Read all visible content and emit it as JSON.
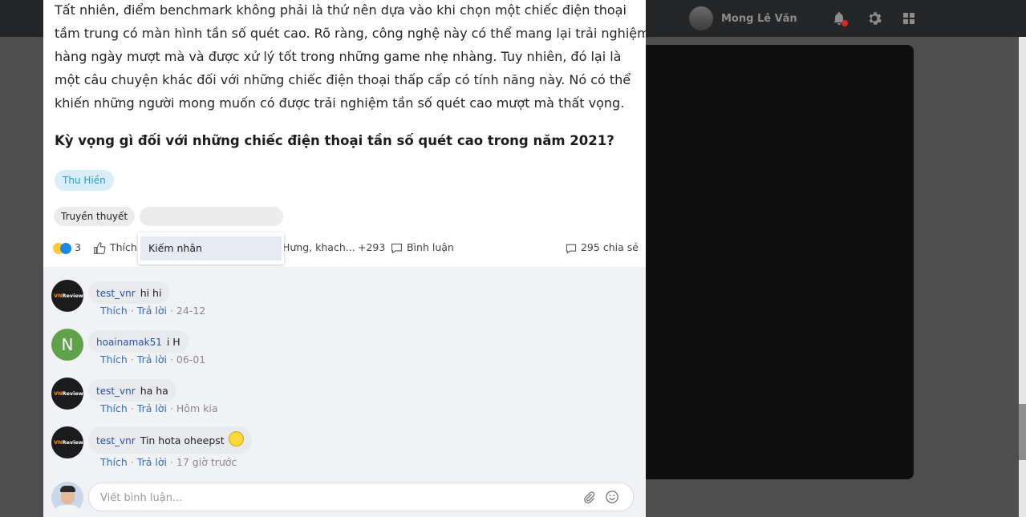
{
  "header": {
    "user_name": "Mong Lê Văn",
    "icons": [
      "bell-icon",
      "gear-icon",
      "grid-icon"
    ]
  },
  "article": {
    "paragraph": "Tất nhiên, điểm benchmark không phải là thứ nên dựa vào khi chọn một chiếc điện thoại tầm trung có màn hình tần số quét cao. Rõ ràng, công nghệ này có thể mang lại trải nghiệm hàng ngày mượt mà và được xử lý tốt trong những game nhẹ nhàng. Tuy nhiên, đó lại là một câu chuyện khác đối với những chiếc điện thoại thấp cấp có tính năng này. Nó có thể khiến những người mong muốn có được trải nghiệm tần số quét cao mượt mà thất vọng.",
    "lines": [
      "Tất nhiên, điểm benchmark không phải là thứ nên dựa vào khi chọn một chiếc điện thoại",
      "tầm trung có màn hình tần số quét cao. Rõ ràng, công nghệ này có thể mang lại trải nghiệm",
      "hàng ngày mượt mà và được xử lý tốt trong những game nhẹ nhàng. Tuy nhiên, đó lại là",
      "một câu chuyện khác đối với những chiếc điện thoại thấp cấp có tính năng này. Nó có thể",
      "khiến những người mong muốn có được trải nghiệm tần số quét cao mượt mà thất vọng."
    ],
    "heading": "Kỳ vọng gì đối với những chiếc điện thoại tần số quét cao trong năm 2021?"
  },
  "author_tag": "Thu Hiền",
  "tags": [
    "Truyền thuyết"
  ],
  "dropdown": {
    "item": "Kiếm nhân"
  },
  "actions": {
    "reaction_count": "3",
    "like_label": "Thích",
    "likers": "Hưng,  khach...",
    "likers_more": "+293",
    "comment_label": "Bình luận",
    "share_label": "295 chia sẻ"
  },
  "comment_actions": {
    "like": "Thích",
    "separator": "·",
    "reply": "Trả lời"
  },
  "comments": [
    {
      "author": "test_vnr",
      "text": "hi hi",
      "time": "24-12",
      "avatar": "vnreview-logo"
    },
    {
      "author": "hoainamak51",
      "text": "i H",
      "time": "06-01",
      "avatar": "N"
    },
    {
      "author": "test_vnr",
      "text": "ha ha",
      "time": "Hôm kia",
      "avatar": "vnreview-logo"
    },
    {
      "author": "test_vnr",
      "text": "Tin hota oheepst",
      "time": "17 giờ trước",
      "avatar": "vnreview-logo"
    }
  ],
  "composer": {
    "placeholder": "Viết bình luận..."
  }
}
